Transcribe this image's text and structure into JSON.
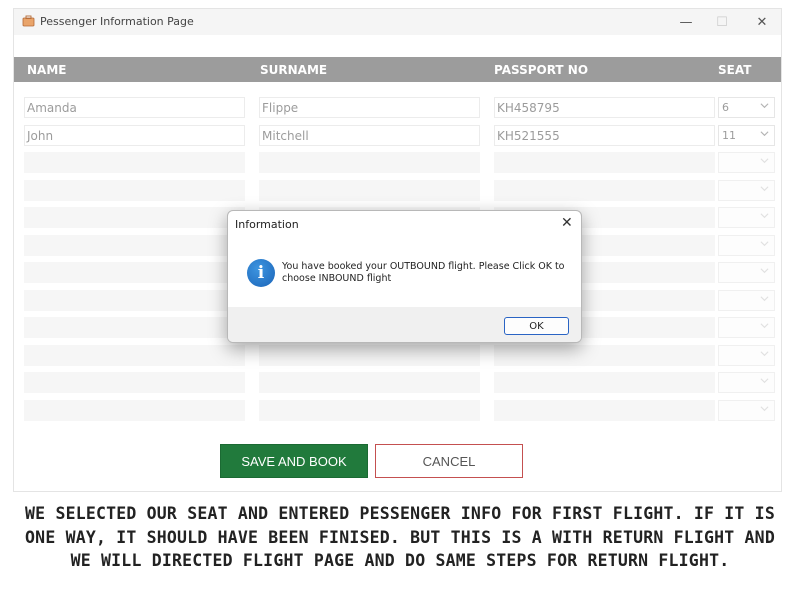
{
  "window": {
    "title": "Pessenger Information Page",
    "controls": {
      "minimize": "—",
      "maximize": "☐",
      "close": "✕"
    }
  },
  "table": {
    "headers": [
      "NAME",
      "SURNAME",
      "PASSPORT NO",
      "SEAT"
    ],
    "rows": [
      {
        "name": "Amanda",
        "surname": "Flippe",
        "passport": "KH458795",
        "seat": "6"
      },
      {
        "name": "John",
        "surname": "Mitchell",
        "passport": "KH521555",
        "seat": "11"
      },
      {
        "name": "",
        "surname": "",
        "passport": "",
        "seat": ""
      },
      {
        "name": "",
        "surname": "",
        "passport": "",
        "seat": ""
      },
      {
        "name": "",
        "surname": "",
        "passport": "",
        "seat": ""
      },
      {
        "name": "",
        "surname": "",
        "passport": "",
        "seat": ""
      },
      {
        "name": "",
        "surname": "",
        "passport": "",
        "seat": ""
      },
      {
        "name": "",
        "surname": "",
        "passport": "",
        "seat": ""
      },
      {
        "name": "",
        "surname": "",
        "passport": "",
        "seat": ""
      },
      {
        "name": "",
        "surname": "",
        "passport": "",
        "seat": ""
      },
      {
        "name": "",
        "surname": "",
        "passport": "",
        "seat": ""
      },
      {
        "name": "",
        "surname": "",
        "passport": "",
        "seat": ""
      }
    ]
  },
  "buttons": {
    "save_label": "SAVE AND BOOK",
    "cancel_label": "CANCEL"
  },
  "dialog": {
    "title": "Information",
    "close": "✕",
    "icon": "info-icon",
    "message": "You have booked your OUTBOUND flight. Please Click OK to choose INBOUND flight",
    "ok_label": "OK"
  },
  "caption": "WE SELECTED OUR SEAT AND ENTERED PESSENGER INFO FOR FIRST FLIGHT. IF IT IS ONE WAY, IT SHOULD HAVE BEEN FINISED. BUT THIS IS A WITH RETURN FLIGHT AND WE WILL DIRECTED FLIGHT PAGE AND DO SAME STEPS FOR RETURN FLIGHT.",
  "colors": {
    "header_bar": "#9c9c9c",
    "save_button": "#217a3c",
    "cancel_border": "#c45050",
    "info_icon": "#1b64b8"
  }
}
